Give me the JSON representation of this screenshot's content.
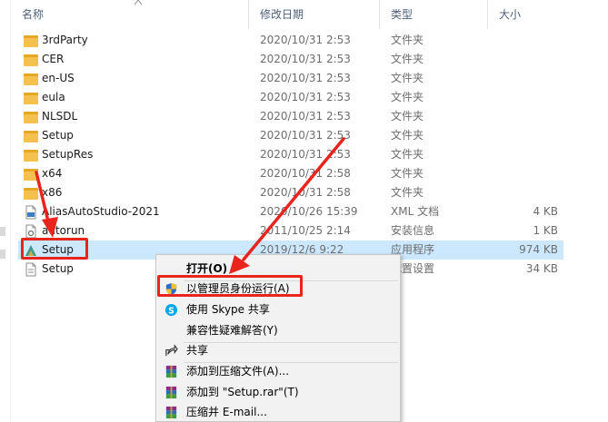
{
  "columns": {
    "name": "名称",
    "date": "修改日期",
    "type": "类型",
    "size": "大小"
  },
  "files": [
    {
      "name": "3rdParty",
      "date": "2020/10/31 2:53",
      "type": "文件夹",
      "size": "",
      "icon": "folder-icon"
    },
    {
      "name": "CER",
      "date": "2020/10/31 2:53",
      "type": "文件夹",
      "size": "",
      "icon": "folder-icon"
    },
    {
      "name": "en-US",
      "date": "2020/10/31 2:53",
      "type": "文件夹",
      "size": "",
      "icon": "folder-icon"
    },
    {
      "name": "eula",
      "date": "2020/10/31 2:53",
      "type": "文件夹",
      "size": "",
      "icon": "folder-icon"
    },
    {
      "name": "NLSDL",
      "date": "2020/10/31 2:53",
      "type": "文件夹",
      "size": "",
      "icon": "folder-icon"
    },
    {
      "name": "Setup",
      "date": "2020/10/31 2:53",
      "type": "文件夹",
      "size": "",
      "icon": "folder-icon"
    },
    {
      "name": "SetupRes",
      "date": "2020/10/31 2:53",
      "type": "文件夹",
      "size": "",
      "icon": "folder-icon"
    },
    {
      "name": "x64",
      "date": "2020/10/31 2:58",
      "type": "文件夹",
      "size": "",
      "icon": "folder-icon"
    },
    {
      "name": "x86",
      "date": "2020/10/31 2:58",
      "type": "文件夹",
      "size": "",
      "icon": "folder-icon"
    },
    {
      "name": "AliasAutoStudio-2021",
      "date": "2020/10/26 15:39",
      "type": "XML 文档",
      "size": "4 KB",
      "icon": "xml-file-icon"
    },
    {
      "name": "autorun",
      "date": "2011/10/25 2:14",
      "type": "安装信息",
      "size": "1 KB",
      "icon": "inf-file-icon"
    },
    {
      "name": "Setup",
      "date": "2019/12/6 9:22",
      "type": "应用程序",
      "size": "974 KB",
      "icon": "autodesk-setup-icon"
    },
    {
      "name": "Setup",
      "date": "",
      "type": "配置设置",
      "size": "34 KB",
      "icon": "ini-file-icon"
    }
  ],
  "context_menu": [
    {
      "label": "打开(O)",
      "icon": ""
    },
    {
      "label": "以管理员身份运行(A)",
      "icon": "uac-shield-icon"
    },
    {
      "label": "使用 Skype 共享",
      "icon": "skype-icon"
    },
    {
      "label": "兼容性疑难解答(Y)",
      "icon": ""
    },
    {
      "label": "共享",
      "icon": "share-icon"
    },
    {
      "label": "添加到压缩文件(A)...",
      "icon": "winrar-icon"
    },
    {
      "label": "添加到 \"Setup.rar\"(T)",
      "icon": "winrar-icon"
    },
    {
      "label": "压缩并 E-mail...",
      "icon": "winrar-icon"
    }
  ],
  "colors": {
    "selection": "#cce8ff",
    "annotation_red": "#e8241d",
    "folder_yellow": "#f4c14e",
    "header_text": "#4c607a"
  }
}
